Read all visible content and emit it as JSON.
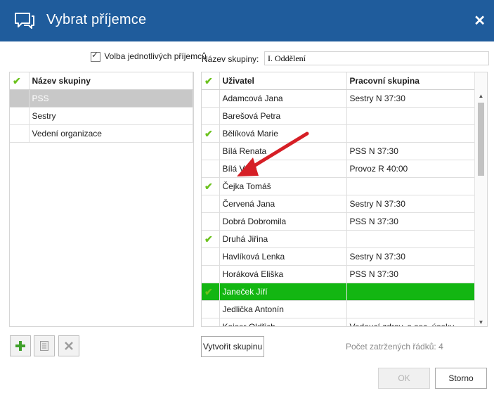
{
  "dialog": {
    "title": "Vybrat příjemce",
    "close_symbol": "✕",
    "title_icon": "chat-icon"
  },
  "options": {
    "checkbox_label": "Volba jednotlivých příjemců",
    "checkbox_checked": true,
    "group_name_label": "Název skupiny:",
    "group_name_value": "I. Oddělení"
  },
  "groups": {
    "header": "Název skupiny",
    "rows": [
      {
        "name": "PSS",
        "checked": false,
        "selected": true
      },
      {
        "name": "Sestry",
        "checked": false,
        "selected": false
      },
      {
        "name": "Vedení organizace",
        "checked": false,
        "selected": false
      }
    ]
  },
  "users": {
    "col_user": "Uživatel",
    "col_group": "Pracovní skupina",
    "rows": [
      {
        "name": "Adamcová Jana",
        "group": "Sestry N 37:30",
        "checked": false
      },
      {
        "name": "Barešová Petra",
        "group": "",
        "checked": false
      },
      {
        "name": "Bělíková Marie",
        "group": "",
        "checked": true
      },
      {
        "name": "Bílá Renata",
        "group": "PSS N 37:30",
        "checked": false
      },
      {
        "name": "Bílá Věra",
        "group": "Provoz R 40:00",
        "checked": false
      },
      {
        "name": "Čejka Tomáš",
        "group": "",
        "checked": true
      },
      {
        "name": "Červená Jana",
        "group": "Sestry N 37:30",
        "checked": false
      },
      {
        "name": "Dobrá Dobromila",
        "group": "PSS N 37:30",
        "checked": false
      },
      {
        "name": "Druhá Jiřina",
        "group": "",
        "checked": true
      },
      {
        "name": "Havlíková Lenka",
        "group": "Sestry N 37:30",
        "checked": false
      },
      {
        "name": "Horáková Eliška",
        "group": "PSS N 37:30",
        "checked": false
      },
      {
        "name": "Janeček Jiří",
        "group": "",
        "checked": true,
        "highlight": true
      },
      {
        "name": "Jedlička Antonín",
        "group": "",
        "checked": false
      },
      {
        "name": "Kaiser Oldřich",
        "group": "Vedoucí zdrav. a soc. úseku",
        "checked": false
      }
    ]
  },
  "toolbar": {
    "add_icon": "plus-icon",
    "edit_icon": "edit-icon",
    "delete_icon": "delete-icon"
  },
  "create_group_button": "Vytvořit skupinu",
  "checked_count": "Počet zatržených řádků: 4",
  "buttons": {
    "ok": "OK",
    "cancel": "Storno"
  },
  "colors": {
    "titlebar": "#1f5c9c",
    "check": "#6cc21e",
    "highlight": "#13b612",
    "selected": "#c8c8c8",
    "annotation_arrow": "#d61f26"
  }
}
